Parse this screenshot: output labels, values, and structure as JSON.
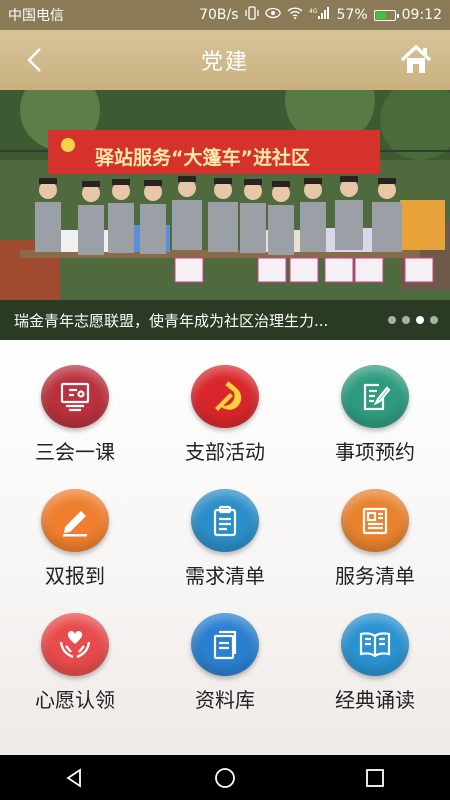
{
  "status": {
    "carrier": "中国电信",
    "speed": "70B/s",
    "signal": "4G",
    "battery": "57%",
    "time": "09:12"
  },
  "header": {
    "title": "党建"
  },
  "banner": {
    "sign_text": "驿站服务“大篷车”进社区",
    "caption": "瑞金青年志愿联盟，使青年成为社区治理生力...",
    "dots": 4,
    "active_dot": 3
  },
  "tiles": [
    {
      "label": "三会一课",
      "icon": "meeting-screen-icon",
      "color": "#b8313c"
    },
    {
      "label": "支部活动",
      "icon": "party-emblem-icon",
      "color": "#d9262c"
    },
    {
      "label": "事项预约",
      "icon": "document-edit-icon",
      "color": "#2e9b7e"
    },
    {
      "label": "双报到",
      "icon": "pencil-sign-icon",
      "color": "#ef7f2e"
    },
    {
      "label": "需求清单",
      "icon": "clipboard-icon",
      "color": "#2b8ec8"
    },
    {
      "label": "服务清单",
      "icon": "newspaper-icon",
      "color": "#e9822e"
    },
    {
      "label": "心愿认领",
      "icon": "heart-hands-icon",
      "color": "#e84b4b"
    },
    {
      "label": "资料库",
      "icon": "books-icon",
      "color": "#2a7fd0"
    },
    {
      "label": "经典诵读",
      "icon": "open-book-icon",
      "color": "#2a92d0"
    }
  ]
}
